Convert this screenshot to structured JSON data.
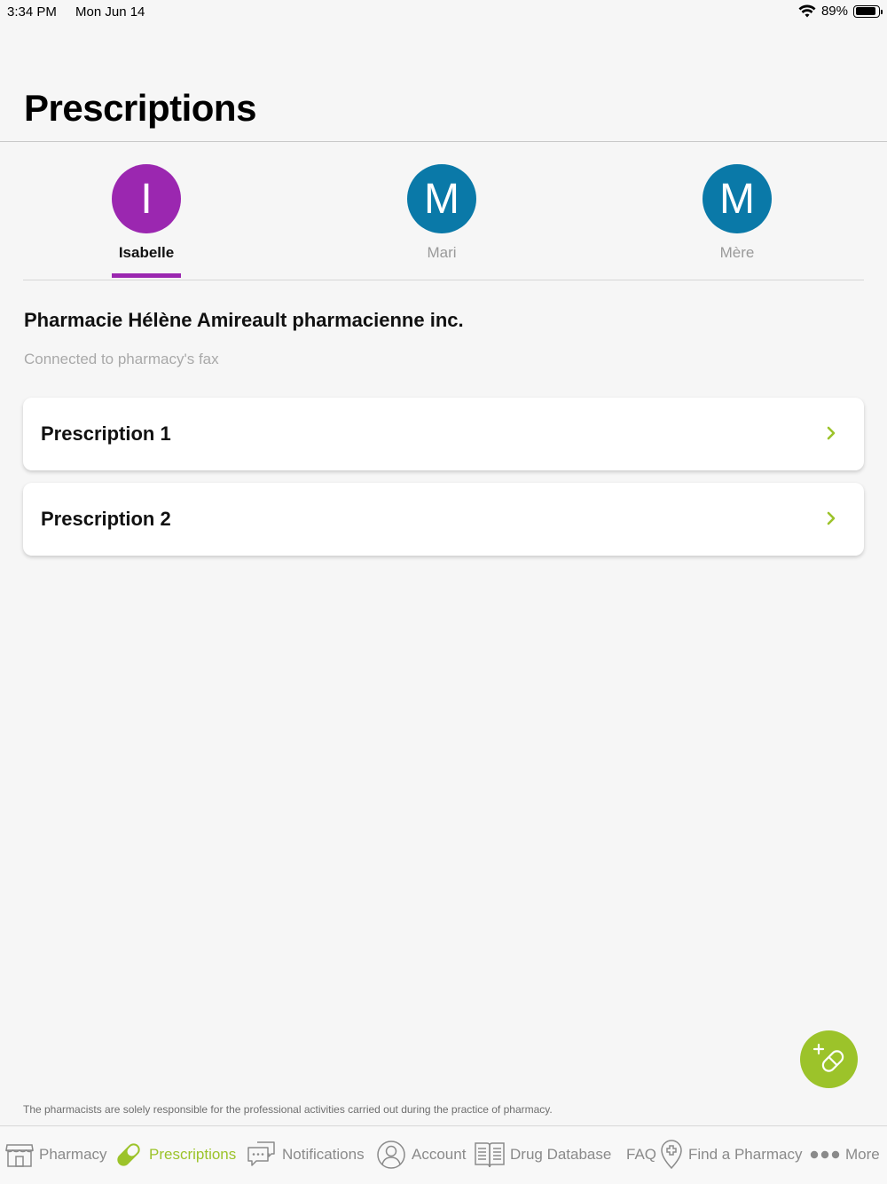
{
  "status_bar": {
    "time": "3:34 PM",
    "date": "Mon Jun 14",
    "battery_percent": "89%",
    "battery_level": 0.89,
    "wifi_icon": "wifi-icon"
  },
  "header": {
    "title": "Prescriptions"
  },
  "profiles": [
    {
      "initial": "I",
      "name": "Isabelle",
      "color": "#9b27b0",
      "active": true
    },
    {
      "initial": "M",
      "name": "Mari",
      "color": "#0a79a8",
      "active": false
    },
    {
      "initial": "M",
      "name": "Mère",
      "color": "#0a79a8",
      "active": false
    }
  ],
  "pharmacy": {
    "name": "Pharmacie Hélène Amireault pharmacienne inc.",
    "subtitle": "Connected to pharmacy's fax"
  },
  "prescriptions": [
    {
      "label": "Prescription 1"
    },
    {
      "label": "Prescription 2"
    }
  ],
  "fab": {
    "icon": "add-pill-icon",
    "color": "#9cc32a"
  },
  "disclaimer": "The pharmacists are solely responsible for the professional activities carried out during the practice of pharmacy.",
  "tabbar": {
    "accent": "#9cc32a",
    "items": [
      {
        "label": "Pharmacy",
        "icon": "storefront-icon",
        "active": false
      },
      {
        "label": "Prescriptions",
        "icon": "pill-icon",
        "active": true
      },
      {
        "label": "Notifications",
        "icon": "chat-bubbles-icon",
        "active": false
      },
      {
        "label": "Account",
        "icon": "person-icon",
        "active": false
      },
      {
        "label": "Drug Database",
        "icon": "book-icon",
        "active": false
      },
      {
        "label": "FAQ",
        "icon": "",
        "active": false
      },
      {
        "label": "Find a Pharmacy",
        "icon": "location-pin-icon",
        "active": false
      },
      {
        "label": "More",
        "icon": "ellipsis-icon",
        "active": false
      }
    ]
  }
}
